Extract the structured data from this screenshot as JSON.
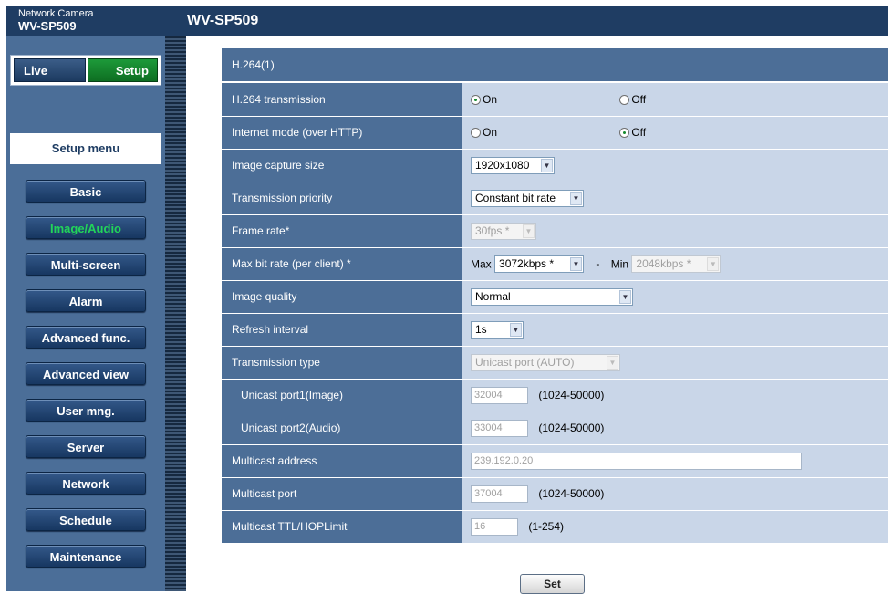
{
  "header": {
    "brand_line1": "Network Camera",
    "brand_model": "WV-SP509",
    "title": "WV-SP509"
  },
  "mode_tabs": {
    "live": "Live",
    "setup": "Setup"
  },
  "sidebar": {
    "menu_label": "Setup menu",
    "items": [
      {
        "label": "Basic"
      },
      {
        "label": "Image/Audio",
        "active": true
      },
      {
        "label": "Multi-screen"
      },
      {
        "label": "Alarm"
      },
      {
        "label": "Advanced func."
      },
      {
        "label": "Advanced view"
      },
      {
        "label": "User mng."
      },
      {
        "label": "Server"
      },
      {
        "label": "Network"
      },
      {
        "label": "Schedule"
      },
      {
        "label": "Maintenance"
      }
    ]
  },
  "form": {
    "section_title": "H.264(1)",
    "h264_transmission": {
      "label": "H.264 transmission",
      "options": [
        "On",
        "Off"
      ],
      "selected": "On"
    },
    "internet_mode": {
      "label": "Internet mode (over HTTP)",
      "options": [
        "On",
        "Off"
      ],
      "selected": "Off"
    },
    "image_capture_size": {
      "label": "Image capture size",
      "value": "1920x1080"
    },
    "transmission_priority": {
      "label": "Transmission priority",
      "value": "Constant bit rate"
    },
    "frame_rate": {
      "label": "Frame rate*",
      "value": "30fps *"
    },
    "max_bit_rate": {
      "label": "Max bit rate (per client) *",
      "max_label": "Max",
      "max_value": "3072kbps *",
      "separator": "-",
      "min_label": "Min",
      "min_value": "2048kbps *"
    },
    "image_quality": {
      "label": "Image quality",
      "value": "Normal"
    },
    "refresh_interval": {
      "label": "Refresh interval",
      "value": "1s"
    },
    "transmission_type": {
      "label": "Transmission type",
      "value": "Unicast port (AUTO)"
    },
    "unicast_port1": {
      "label": "Unicast port1(Image)",
      "value": "32004",
      "range": "(1024-50000)"
    },
    "unicast_port2": {
      "label": "Unicast port2(Audio)",
      "value": "33004",
      "range": "(1024-50000)"
    },
    "multicast_address": {
      "label": "Multicast address",
      "value": "239.192.0.20"
    },
    "multicast_port": {
      "label": "Multicast port",
      "value": "37004",
      "range": "(1024-50000)"
    },
    "multicast_ttl": {
      "label": "Multicast TTL/HOPLimit",
      "value": "16",
      "range": "(1-254)"
    },
    "set_label": "Set"
  },
  "colors": {
    "header_bg": "#1f3d63",
    "sidebar_bg": "#4b6e98",
    "label_cell_bg": "#4c6e97",
    "value_cell_bg": "#c9d6e8",
    "setup_green": "#1d9a3a",
    "active_menu_text": "#22d45a"
  }
}
